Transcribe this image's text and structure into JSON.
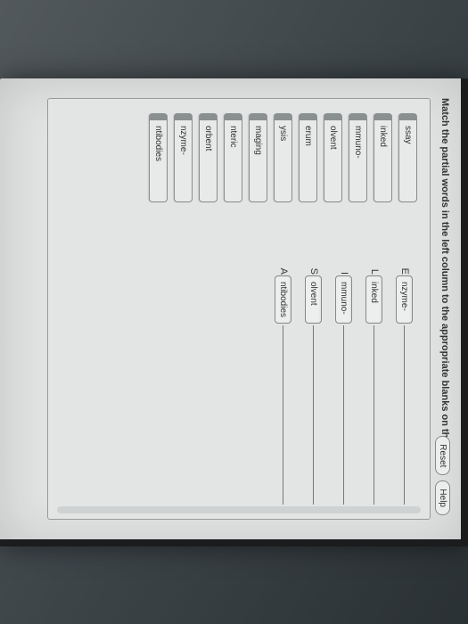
{
  "instruction": "Match the partial words in the left column to the appropriate blanks on the right.",
  "controls": {
    "reset": "Reset",
    "help": "Help"
  },
  "left_words": [
    "ssay",
    "inked",
    "mmuno-",
    "olvent",
    "erum",
    "ysis",
    "maging",
    "nteric",
    "orbent",
    "nzyme-",
    "ntibodies"
  ],
  "right_targets": [
    {
      "prefix": "E",
      "slot": "nzyme-"
    },
    {
      "prefix": "L",
      "slot": "inked"
    },
    {
      "prefix": "I",
      "slot": "mmuno-"
    },
    {
      "prefix": "S",
      "slot": "olvent"
    },
    {
      "prefix": "A",
      "slot": "ntibodies"
    }
  ]
}
